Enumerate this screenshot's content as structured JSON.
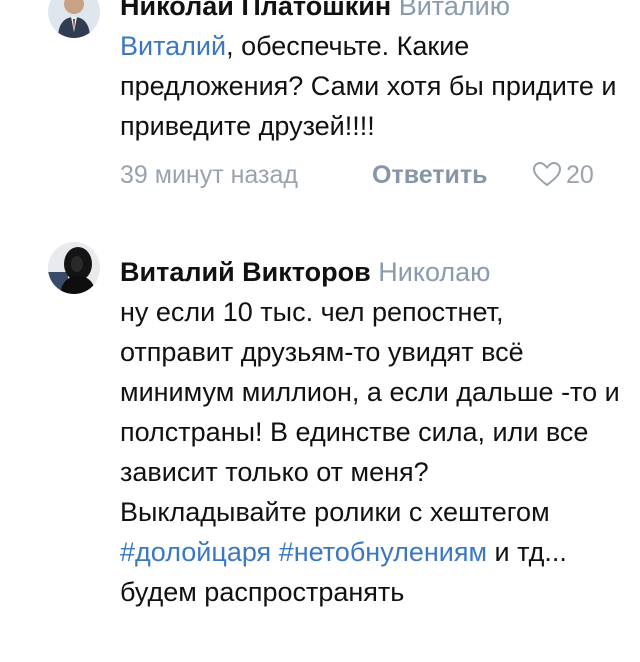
{
  "comments": [
    {
      "author": "Николай Платошкин",
      "reply_to": "Виталию",
      "mention": "Виталий",
      "text": ", обеспечьте. Какие предложения? Сами хотя бы придите и приведите друзей!!!!",
      "time": "39 минут назад",
      "reply_label": "Ответить",
      "likes": "20",
      "heart_icon": "heart-outline-icon"
    },
    {
      "author": "Виталий Викторов",
      "reply_to": "Николаю",
      "text": "ну если 10 тыс. чел репостнет, отправит друзьям-то увидят всё минимум миллион, а если дальше -то и полстраны! В единстве сила, или все зависит только от меня? Выкладывайте ролики с хештегом ",
      "hashtag1": "#долойцаря",
      "hashtag2": "#нетобнулениям",
      "text_end": " и тд... будем распространять"
    }
  ],
  "colors": {
    "link": "#3b78c4",
    "meta": "#9aa3ad",
    "reply_to": "#8a9bb0"
  }
}
